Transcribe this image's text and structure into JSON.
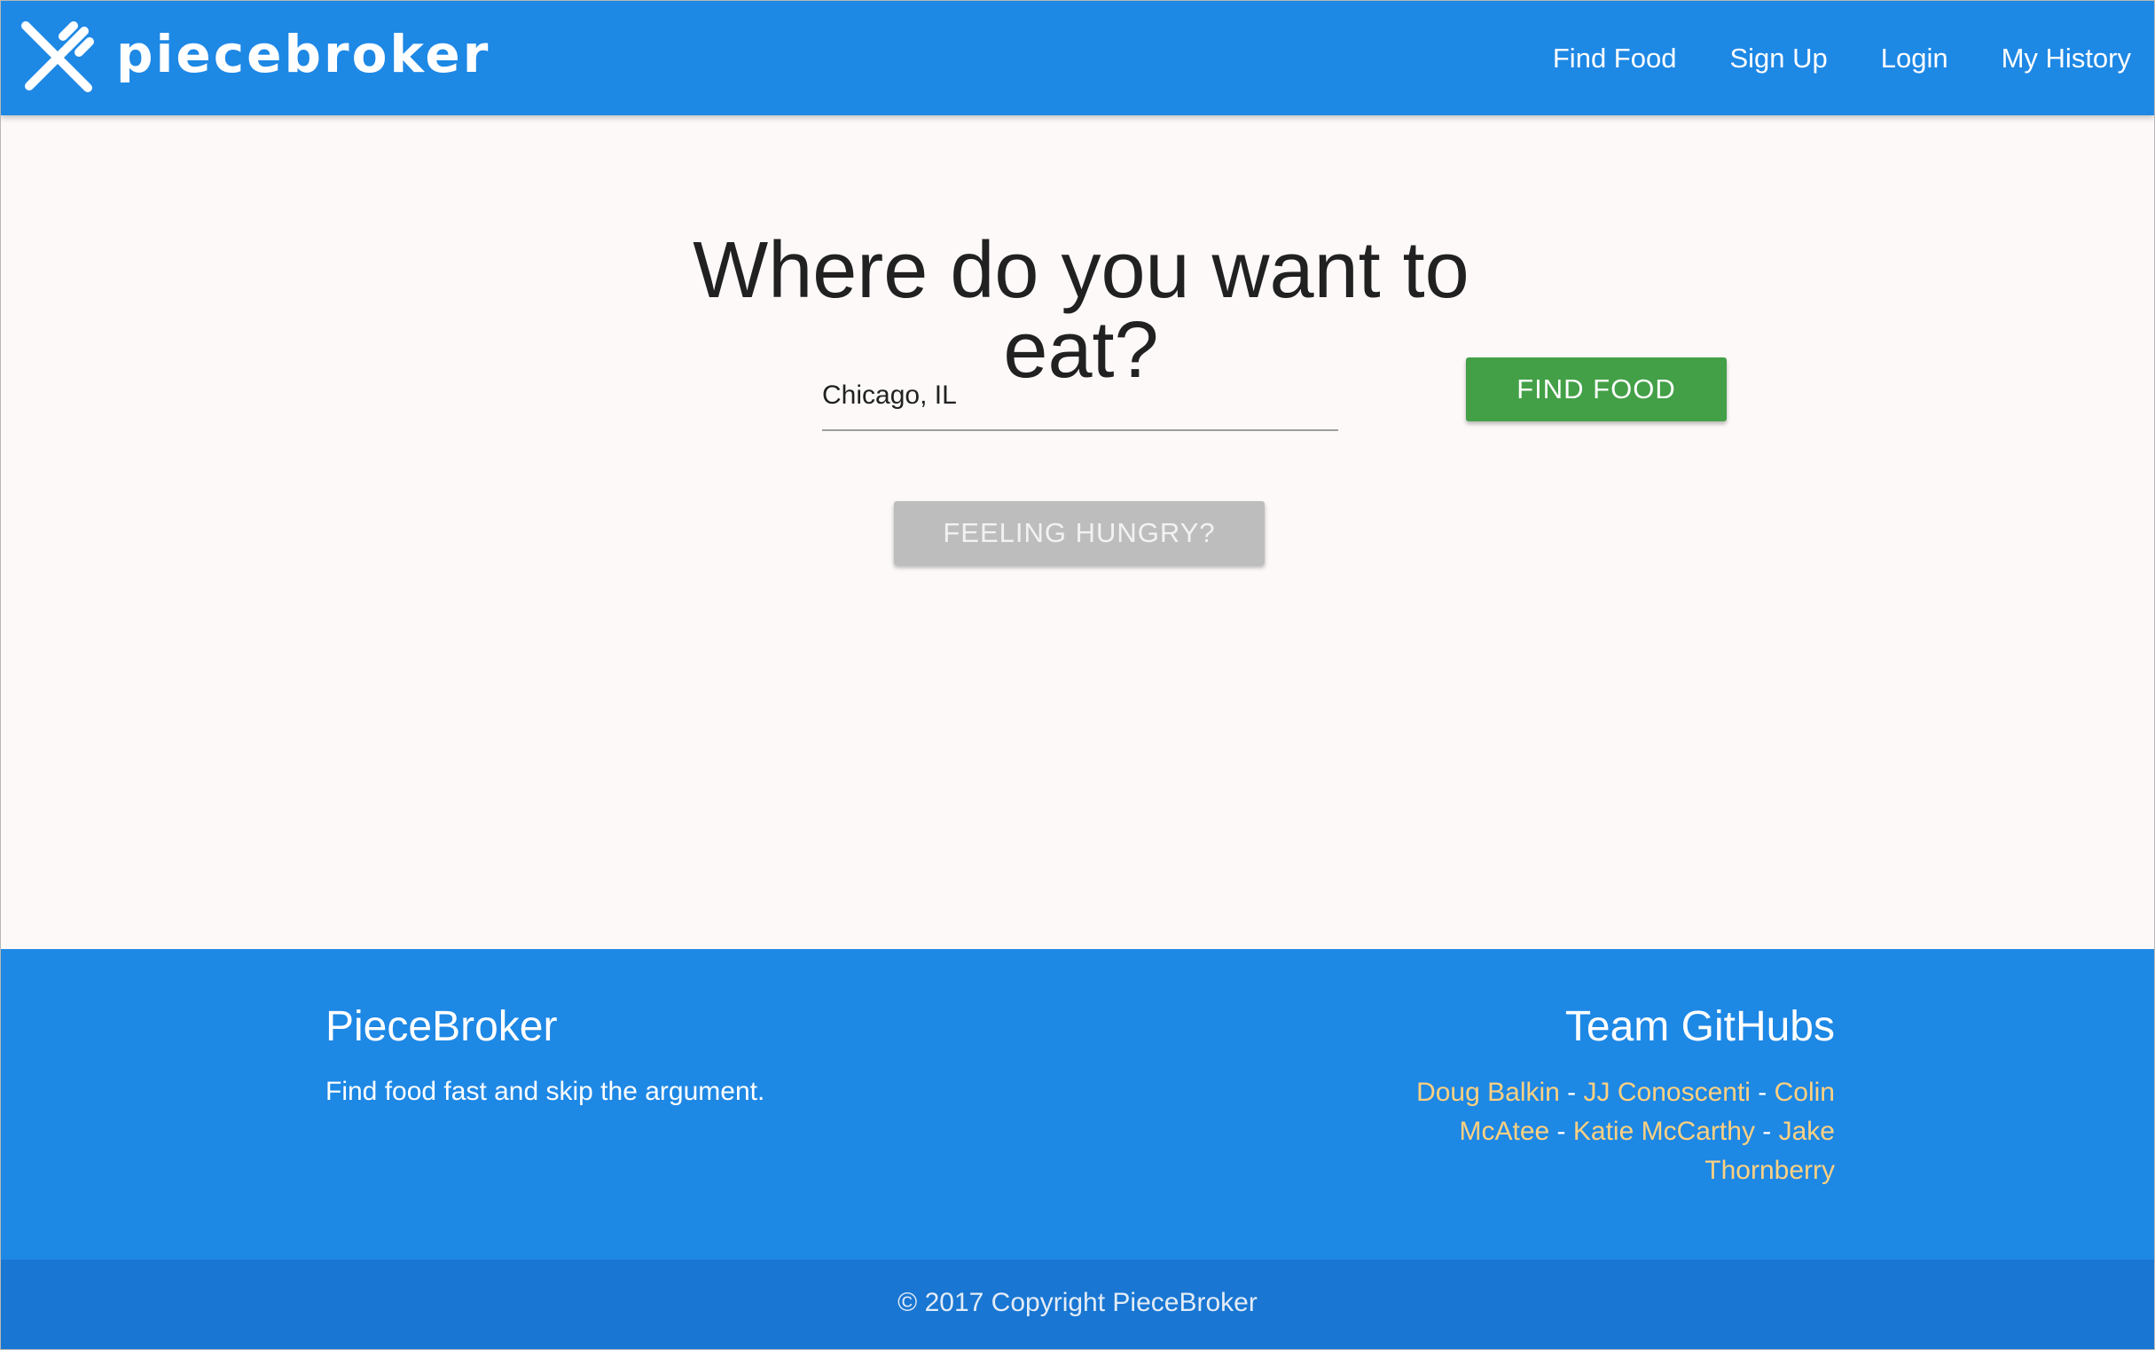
{
  "navbar": {
    "brand_icon": "fork-knife-cross-icon",
    "brand_name": "piecebroker",
    "links": [
      {
        "label": "Find Food"
      },
      {
        "label": "Sign Up"
      },
      {
        "label": "Login"
      },
      {
        "label": "My History"
      }
    ]
  },
  "main": {
    "headline": "Where do you want to eat?",
    "location_input_value": "Chicago, IL",
    "find_food_label": "FIND FOOD",
    "feeling_hungry_label": "FEELING HUNGRY?"
  },
  "footer": {
    "brand_title": "PieceBroker",
    "tagline": "Find food fast and skip the argument.",
    "team_title": "Team GitHubs",
    "team_members": [
      {
        "name": "Doug Balkin"
      },
      {
        "name": "JJ Conoscenti"
      },
      {
        "name": "Colin McAtee"
      },
      {
        "name": "Katie McCarthy"
      },
      {
        "name": "Jake Thornberry"
      }
    ],
    "separator": " - ",
    "copyright": "© 2017 Copyright PieceBroker"
  },
  "colors": {
    "primary": "#1e88e5",
    "primary_dark": "#1976d2",
    "find_button": "#43a047",
    "hungry_button": "#bdbdbd",
    "team_link": "#ffd180",
    "background": "#fcf9f8"
  }
}
